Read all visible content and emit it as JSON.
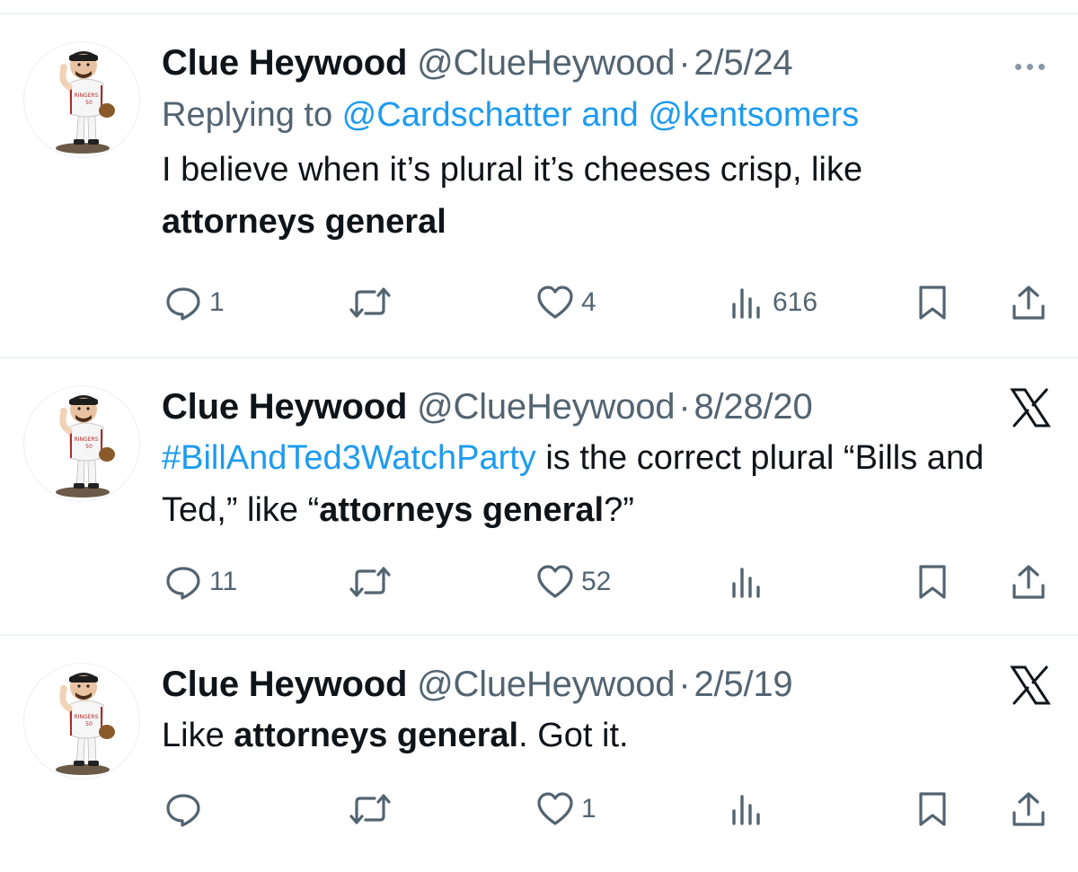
{
  "tweets": [
    {
      "name": "Clue Heywood",
      "handle": "@ClueHeywood",
      "separator": "·",
      "date": "2/5/24",
      "reply": {
        "prefix": "Replying to ",
        "mention1": "@Cardschatter",
        "joiner": " and ",
        "mention2": "@kentsomers"
      },
      "text": {
        "part1": "I believe when it’s plural it’s cheeses crisp, like ",
        "bold1": "attorneys general"
      },
      "stats": {
        "replies": "1",
        "likes": "4",
        "views": "616"
      },
      "corner_icon": "more-dots-icon"
    },
    {
      "name": "Clue Heywood",
      "handle": "@ClueHeywood",
      "separator": "·",
      "date": "8/28/20",
      "text": {
        "hashtag": "#BillAndTed3WatchParty",
        "part1": " is the correct plural “Bills and Ted,” like “",
        "bold1": "attorneys general",
        "part2": "?”"
      },
      "stats": {
        "replies": "11",
        "likes": "52",
        "views": ""
      },
      "corner_icon": "x-logo-icon"
    },
    {
      "name": "Clue Heywood",
      "handle": "@ClueHeywood",
      "separator": "·",
      "date": "2/5/19",
      "text": {
        "part1": "Like ",
        "bold1": "attorneys general",
        "part2": ". Got it."
      },
      "stats": {
        "replies": "",
        "likes": "1",
        "views": ""
      },
      "corner_icon": "x-logo-icon"
    }
  ],
  "avatar_jersey_text": "RINGERS",
  "avatar_jersey_number": "50",
  "colors": {
    "text": "#0f1419",
    "secondary": "#536471",
    "link": "#1d9bf0",
    "divider": "#eff3f4"
  }
}
